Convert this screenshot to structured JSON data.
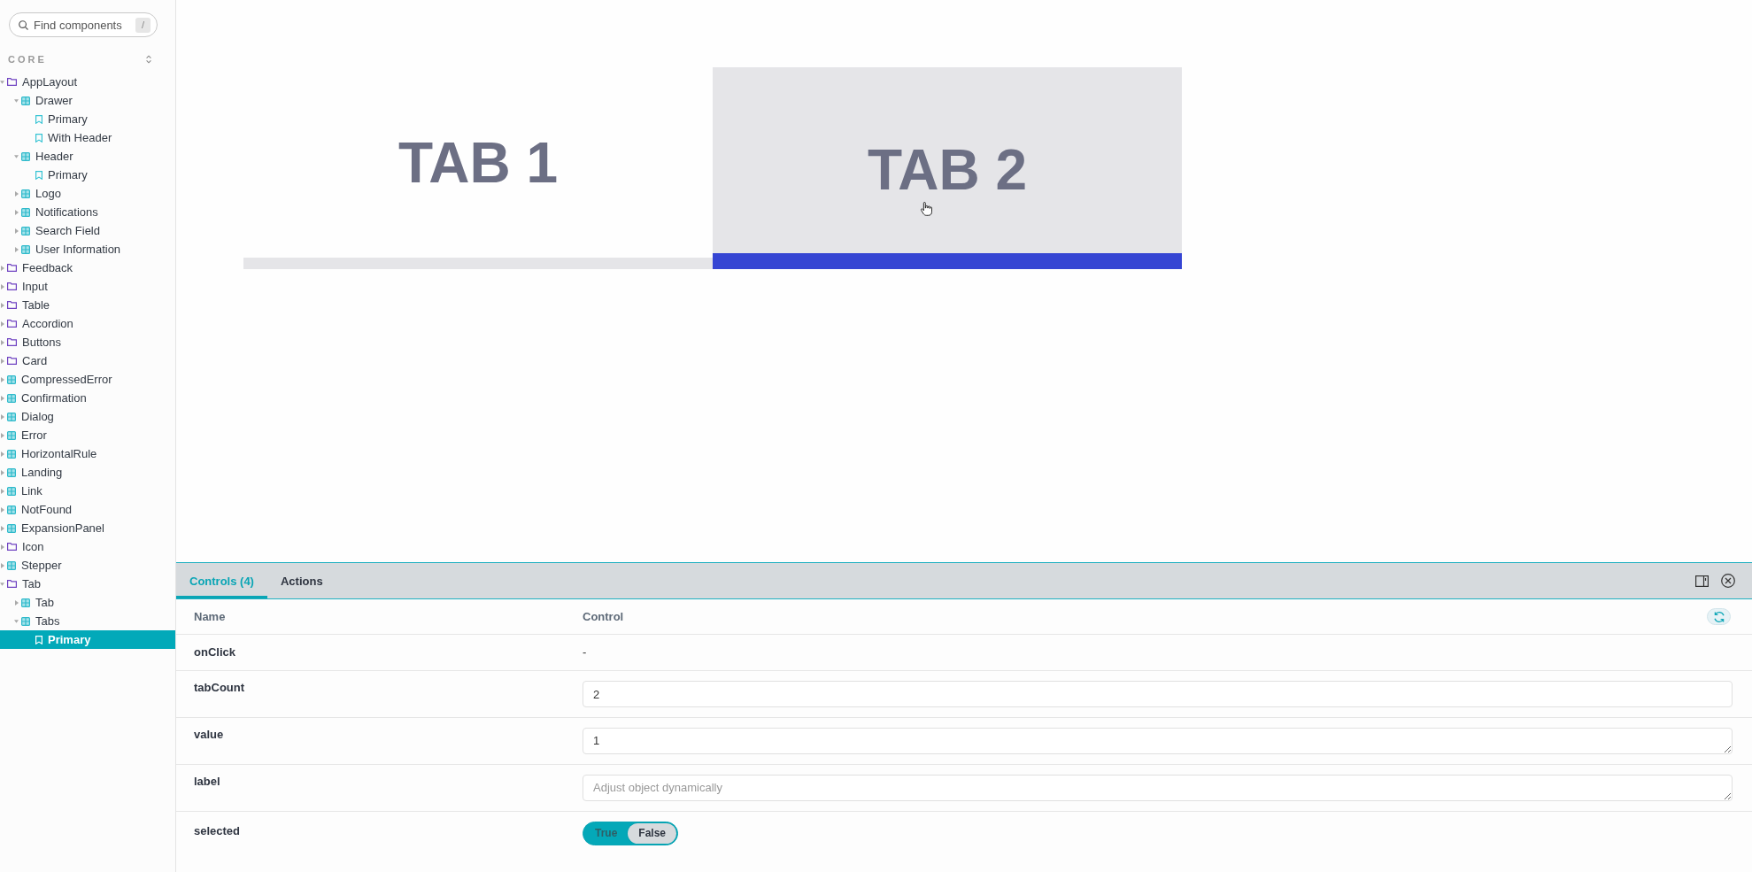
{
  "sidebar": {
    "search": {
      "placeholder": "Find components",
      "shortcut": "/"
    },
    "section": {
      "label": "CORE"
    },
    "tree": [
      {
        "kind": "folder",
        "label": "AppLayout",
        "expanded": true,
        "selected": false,
        "children": [
          {
            "kind": "component",
            "label": "Drawer",
            "expanded": true,
            "selected": false,
            "children": [
              {
                "kind": "story",
                "label": "Primary",
                "selected": false
              },
              {
                "kind": "story",
                "label": "With Header",
                "selected": false
              }
            ]
          },
          {
            "kind": "component",
            "label": "Header",
            "expanded": true,
            "selected": false,
            "children": [
              {
                "kind": "story",
                "label": "Primary",
                "selected": false
              }
            ]
          },
          {
            "kind": "component",
            "label": "Logo",
            "expanded": false,
            "selected": false
          },
          {
            "kind": "component",
            "label": "Notifications",
            "expanded": false,
            "selected": false
          },
          {
            "kind": "component",
            "label": "Search Field",
            "expanded": false,
            "selected": false
          },
          {
            "kind": "component",
            "label": "User Information",
            "expanded": false,
            "selected": false
          }
        ]
      },
      {
        "kind": "folder",
        "label": "Feedback",
        "expanded": false,
        "selected": false
      },
      {
        "kind": "folder",
        "label": "Input",
        "expanded": false,
        "selected": false
      },
      {
        "kind": "folder",
        "label": "Table",
        "expanded": false,
        "selected": false
      },
      {
        "kind": "folder",
        "label": "Accordion",
        "expanded": false,
        "selected": false
      },
      {
        "kind": "folder",
        "label": "Buttons",
        "expanded": false,
        "selected": false
      },
      {
        "kind": "folder",
        "label": "Card",
        "expanded": false,
        "selected": false
      },
      {
        "kind": "component",
        "label": "CompressedError",
        "expanded": false,
        "selected": false
      },
      {
        "kind": "component",
        "label": "Confirmation",
        "expanded": false,
        "selected": false
      },
      {
        "kind": "component",
        "label": "Dialog",
        "expanded": false,
        "selected": false
      },
      {
        "kind": "component",
        "label": "Error",
        "expanded": false,
        "selected": false
      },
      {
        "kind": "component",
        "label": "HorizontalRule",
        "expanded": false,
        "selected": false
      },
      {
        "kind": "component",
        "label": "Landing",
        "expanded": false,
        "selected": false
      },
      {
        "kind": "component",
        "label": "Link",
        "expanded": false,
        "selected": false
      },
      {
        "kind": "component",
        "label": "NotFound",
        "expanded": false,
        "selected": false
      },
      {
        "kind": "component",
        "label": "ExpansionPanel",
        "expanded": false,
        "selected": false
      },
      {
        "kind": "folder",
        "label": "Icon",
        "expanded": false,
        "selected": false
      },
      {
        "kind": "component",
        "label": "Stepper",
        "expanded": false,
        "selected": false
      },
      {
        "kind": "folder",
        "label": "Tab",
        "expanded": true,
        "selected": false,
        "children": [
          {
            "kind": "component",
            "label": "Tab",
            "expanded": false,
            "selected": false
          },
          {
            "kind": "component",
            "label": "Tabs",
            "expanded": true,
            "selected": false,
            "children": [
              {
                "kind": "story",
                "label": "Primary",
                "selected": true
              }
            ]
          }
        ]
      }
    ]
  },
  "canvas": {
    "tabs": [
      {
        "label": "TAB 1",
        "selected": false
      },
      {
        "label": "TAB 2",
        "selected": true
      }
    ]
  },
  "addons_panel": {
    "tabs": [
      {
        "label": "Controls (4)",
        "selected": true
      },
      {
        "label": "Actions",
        "selected": false
      }
    ],
    "table": {
      "columns": [
        "Name",
        "Control"
      ],
      "rows": [
        {
          "name": "onClick",
          "kind": "text",
          "value": "-"
        },
        {
          "name": "tabCount",
          "kind": "number",
          "value": "2"
        },
        {
          "name": "value",
          "kind": "textarea",
          "value": "1"
        },
        {
          "name": "label",
          "kind": "textarea",
          "placeholder": "Adjust object dynamically"
        },
        {
          "name": "selected",
          "kind": "boolean",
          "options": [
            {
              "label": "True",
              "selected": false
            },
            {
              "label": "False",
              "selected": true
            }
          ]
        }
      ]
    }
  }
}
